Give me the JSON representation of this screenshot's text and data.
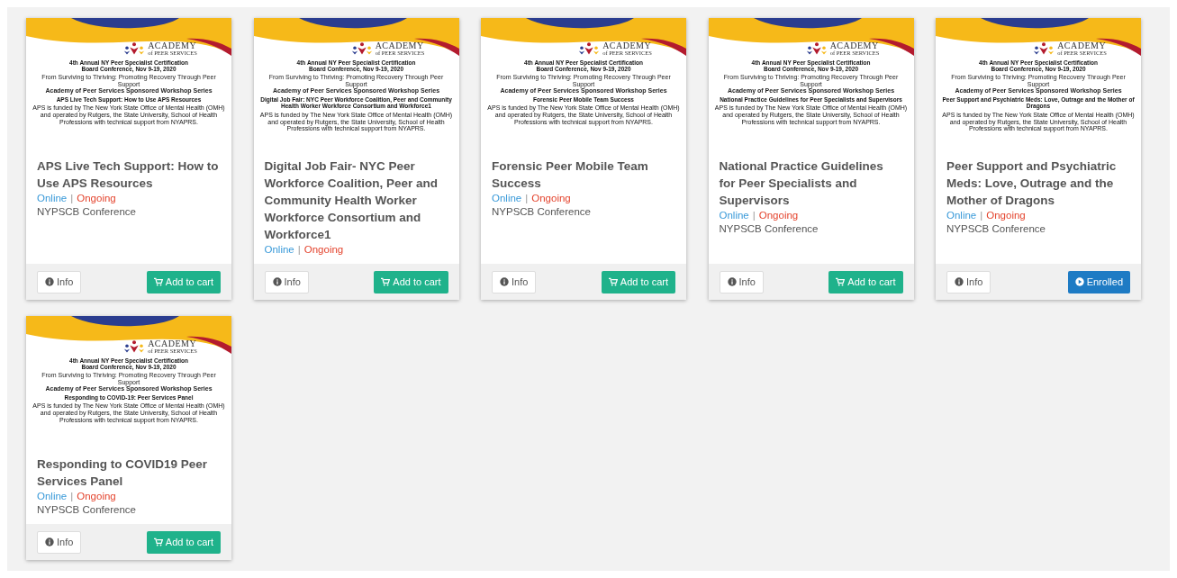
{
  "courses": [
    {
      "banner": {
        "logo_top": "ACADEMY",
        "logo_bottom": "of PEER SERVICES",
        "heading": "4th Annual NY Peer Specialist Certification Board Conference, Nov 9-19, 2020",
        "tagline": "From Surviving to Thriving: Promoting Recovery Through Peer Support",
        "series": "Academy of Peer Services Sponsored Workshop Series",
        "session": "APS Live Tech Support: How to Use APS Resources",
        "funding": "APS is funded by The New York State Office of Mental Health (OMH) and operated by Rutgers, the State University, School of Health Professions with technical support from NYAPRS."
      },
      "title": "APS Live Tech Support: How to Use APS Resources",
      "mode": "Online",
      "separator": "|",
      "status": "Ongoing",
      "category": "NYPSCB Conference",
      "info": "Info",
      "action": {
        "kind": "cart",
        "label": "Add to cart"
      }
    },
    {
      "banner": {
        "logo_top": "ACADEMY",
        "logo_bottom": "of PEER SERVICES",
        "heading": "4th Annual NY Peer Specialist Certification Board Conference, Nov 9-19, 2020",
        "tagline": "From Surviving to Thriving: Promoting Recovery Through Peer Support",
        "series": "Academy of Peer Services Sponsored Workshop Series",
        "session": "Digital Job Fair: NYC Peer Workforce Coalition, Peer and Community Health Worker Workforce Consortium and Workforce1",
        "funding": "APS is funded by The New York State Office of Mental Health (OMH) and operated by Rutgers, the State University, School of Health Professions with technical support from NYAPRS."
      },
      "title": "Digital Job Fair- NYC Peer Workforce Coalition, Peer and Community Health Worker Workforce Consortium and Workforce1",
      "mode": "Online",
      "separator": "|",
      "status": "Ongoing",
      "info": "Info",
      "action": {
        "kind": "cart",
        "label": "Add to cart"
      }
    },
    {
      "banner": {
        "logo_top": "ACADEMY",
        "logo_bottom": "of PEER SERVICES",
        "heading": "4th Annual NY Peer Specialist Certification Board Conference, Nov 9-19, 2020",
        "tagline": "From Surviving to Thriving: Promoting Recovery Through Peer Support",
        "series": "Academy of Peer Services Sponsored Workshop Series",
        "session": "Forensic Peer Mobile Team Success",
        "funding": "APS is funded by The New York State Office of Mental Health (OMH) and operated by Rutgers, the State University, School of Health Professions with technical support from NYAPRS."
      },
      "title": "Forensic Peer Mobile Team Success",
      "mode": "Online",
      "separator": "|",
      "status": "Ongoing",
      "category": "NYPSCB Conference",
      "info": "Info",
      "action": {
        "kind": "cart",
        "label": "Add to cart"
      }
    },
    {
      "banner": {
        "logo_top": "ACADEMY",
        "logo_bottom": "of PEER SERVICES",
        "heading": "4th Annual NY Peer Specialist Certification Board Conference, Nov 9-19, 2020",
        "tagline": "From Surviving to Thriving: Promoting Recovery Through Peer Support",
        "series": "Academy of Peer Services Sponsored Workshop Series",
        "session": "National Practice Guidelines for Peer Specialists and Supervisors",
        "funding": "APS is funded by The New York State Office of Mental Health (OMH) and operated by Rutgers, the State University, School of Health Professions with technical support from NYAPRS."
      },
      "title": "National Practice Guidelines for Peer Specialists and Supervisors",
      "mode": "Online",
      "separator": "|",
      "status": "Ongoing",
      "category": "NYPSCB Conference",
      "info": "Info",
      "action": {
        "kind": "cart",
        "label": "Add to cart"
      }
    },
    {
      "banner": {
        "logo_top": "ACADEMY",
        "logo_bottom": "of PEER SERVICES",
        "heading": "4th Annual NY Peer Specialist Certification Board Conference, Nov 9-19, 2020",
        "tagline": "From Surviving to Thriving: Promoting Recovery Through Peer Support",
        "series": "Academy of Peer Services Sponsored Workshop Series",
        "session": "Peer Support and Psychiatric Meds: Love, Outrage and the Mother of Dragons",
        "funding": "APS is funded by The New York State Office of Mental Health (OMH) and operated by Rutgers, the State University, School of Health Professions with technical support from NYAPRS."
      },
      "title": "Peer Support and Psychiatric Meds: Love, Outrage and the Mother of Dragons",
      "mode": "Online",
      "separator": "|",
      "status": "Ongoing",
      "category": "NYPSCB Conference",
      "info": "Info",
      "action": {
        "kind": "enrolled",
        "label": "Enrolled"
      }
    },
    {
      "banner": {
        "logo_top": "ACADEMY",
        "logo_bottom": "of PEER SERVICES",
        "heading": "4th Annual NY Peer Specialist Certification Board Conference, Nov 9-19, 2020",
        "tagline": "From Surviving to Thriving: Promoting Recovery Through Peer Support",
        "series": "Academy of Peer Services Sponsored Workshop Series",
        "session": "Responding to COVID-19: Peer Services Panel",
        "funding": "APS is funded by The New York State Office of Mental Health (OMH) and operated by Rutgers, the State University, School of Health Professions with technical support from NYAPRS."
      },
      "title": "Responding to COVID19 Peer Services Panel",
      "mode": "Online",
      "separator": "|",
      "status": "Ongoing",
      "category": "NYPSCB Conference",
      "info": "Info",
      "action": {
        "kind": "cart",
        "label": "Add to cart"
      }
    }
  ]
}
